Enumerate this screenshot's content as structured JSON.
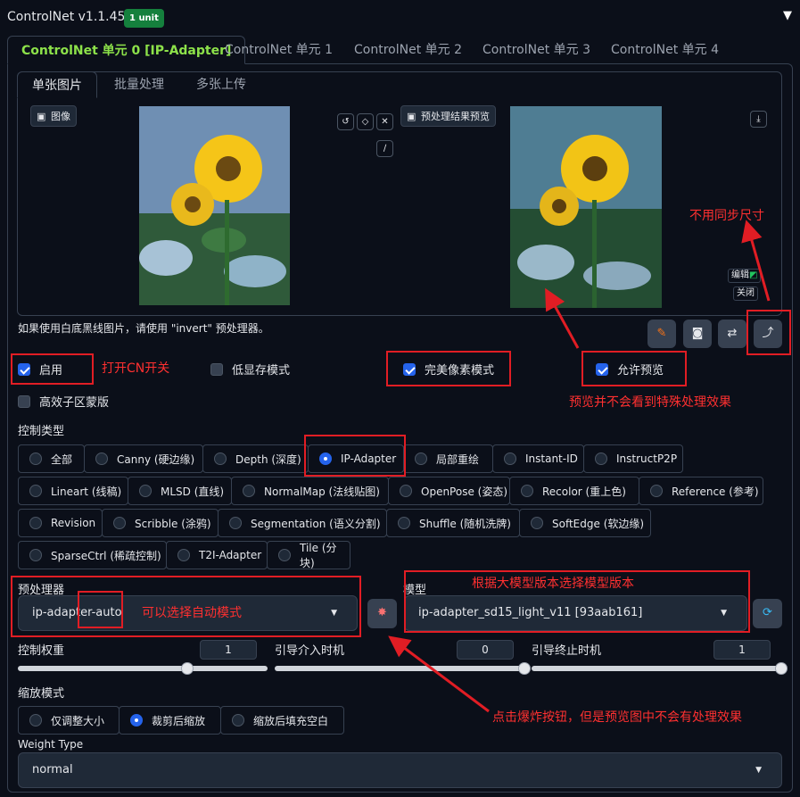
{
  "header": {
    "title": "ControlNet v1.1.455",
    "badge": "1 unit"
  },
  "unit_tabs": [
    "ControlNet 单元 0 [IP-Adapter]",
    "ControlNet 单元 1",
    "ControlNet 单元 2",
    "ControlNet 单元 3",
    "ControlNet 单元 4"
  ],
  "sub_tabs": [
    "单张图片",
    "批量处理",
    "多张上传"
  ],
  "image_panel": {
    "image_label": "图像",
    "preview_label": "预处理结果预览",
    "edit_label": "编辑",
    "close_label": "关闭"
  },
  "hint": "如果使用白底黑线图片，请使用 \"invert\" 预处理器。",
  "checkboxes": {
    "enable": "启用",
    "low_vram": "低显存模式",
    "pixel_perfect": "完美像素模式",
    "allow_preview": "允许预览",
    "efficient_mask": "高效子区蒙版"
  },
  "control_type": {
    "label": "控制类型",
    "rows": [
      [
        "全部",
        "Canny (硬边缘)",
        "Depth (深度)",
        "IP-Adapter",
        "局部重绘",
        "Instant-ID",
        "InstructP2P"
      ],
      [
        "Lineart (线稿)",
        "MLSD (直线)",
        "NormalMap (法线贴图)",
        "OpenPose (姿态)",
        "Recolor (重上色)",
        "Reference (参考)"
      ],
      [
        "Revision",
        "Scribble (涂鸦)",
        "Segmentation (语义分割)",
        "Shuffle (随机洗牌)",
        "SoftEdge (软边缘)"
      ],
      [
        "SparseCtrl (稀疏控制)",
        "T2I-Adapter",
        "Tile (分块)"
      ]
    ],
    "selected": "IP-Adapter"
  },
  "preprocessor": {
    "label": "预处理器",
    "value": "ip-adapter-auto"
  },
  "model": {
    "label": "模型",
    "value": "ip-adapter_sd15_light_v11 [93aab161]"
  },
  "sliders": {
    "weight": {
      "label": "控制权重",
      "value": "1",
      "fraction": 0.68
    },
    "start": {
      "label": "引导介入时机",
      "value": "0",
      "fraction": 1.0
    },
    "end": {
      "label": "引导终止时机",
      "value": "1",
      "fraction": 1.0
    }
  },
  "resize_mode": {
    "label": "缩放模式",
    "options": [
      "仅调整大小",
      "裁剪后缩放",
      "缩放后填充空白"
    ],
    "selected": "裁剪后缩放"
  },
  "weight_type": {
    "label": "Weight Type",
    "value": "normal"
  },
  "annotations": {
    "enable_cn": "打开CN开关",
    "no_sync": "不用同步尺寸",
    "preview_note": "预览并不会看到特殊处理效果",
    "model_note": "根据大模型版本选择模型版本",
    "auto_mode": "可以选择自动模式",
    "explode_note": "点击爆炸按钮，但是预览图中不会有处理效果"
  },
  "colors": {
    "accent_green": "#8de24a",
    "badge_green": "#15803d",
    "annotation_red": "#e11d24",
    "check_blue": "#2563eb"
  }
}
